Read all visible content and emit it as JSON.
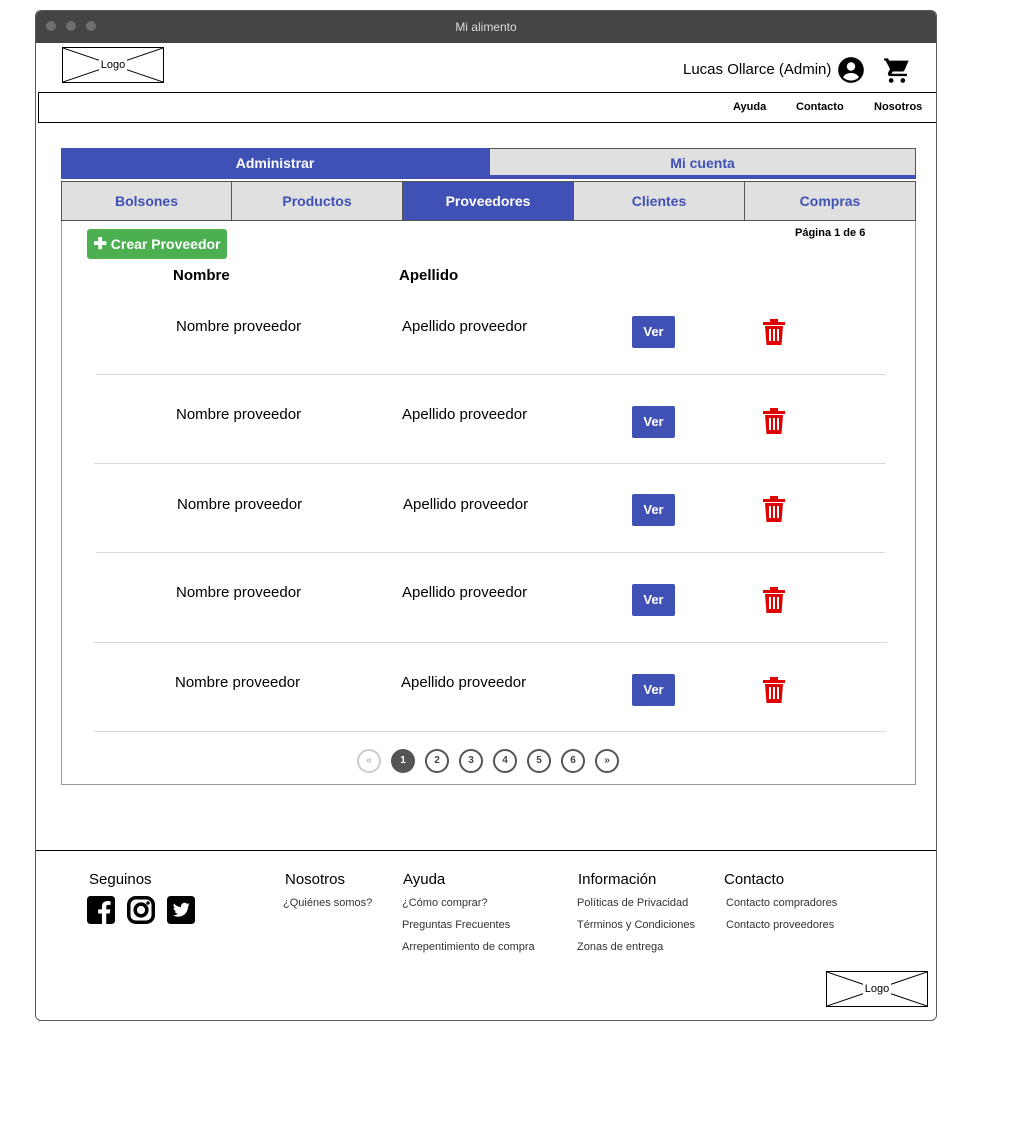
{
  "window": {
    "title": "Mi alimento"
  },
  "header": {
    "logo": "Logo",
    "user": "Lucas Ollarce (Admin)"
  },
  "nav": {
    "links": [
      "Ayuda",
      "Contacto",
      "Nosotros"
    ]
  },
  "main_tabs": [
    "Administrar",
    "Mi cuenta"
  ],
  "sub_tabs": [
    "Bolsones",
    "Productos",
    "Proveedores",
    "Clientes",
    "Compras"
  ],
  "toolbar": {
    "create_label": "Crear Proveedor",
    "page_info": "Página 1 de 6"
  },
  "table": {
    "columns": [
      "Nombre",
      "Apellido"
    ],
    "rows": [
      {
        "nombre": "Nombre proveedor",
        "apellido": "Apellido proveedor",
        "action": "Ver"
      },
      {
        "nombre": "Nombre proveedor",
        "apellido": "Apellido proveedor",
        "action": "Ver"
      },
      {
        "nombre": "Nombre proveedor",
        "apellido": "Apellido proveedor",
        "action": "Ver"
      },
      {
        "nombre": "Nombre proveedor",
        "apellido": "Apellido proveedor",
        "action": "Ver"
      },
      {
        "nombre": "Nombre proveedor",
        "apellido": "Apellido proveedor",
        "action": "Ver"
      }
    ]
  },
  "pagination": {
    "pages": [
      "1",
      "2",
      "3",
      "4",
      "5",
      "6"
    ],
    "current": "1",
    "prev": "«",
    "next": "»"
  },
  "footer": {
    "seguinos": "Seguinos",
    "nosotros": {
      "title": "Nosotros",
      "links": [
        "¿Quiénes somos?"
      ]
    },
    "ayuda": {
      "title": "Ayuda",
      "links": [
        "¿Cómo comprar?",
        "Preguntas Frecuentes",
        "Arrepentimiento de compra"
      ]
    },
    "informacion": {
      "title": "Información",
      "links": [
        "Políticas de Privacidad",
        "Términos y Condiciones",
        "Zonas de entrega"
      ]
    },
    "contacto": {
      "title": "Contacto",
      "links": [
        "Contacto compradores",
        "Contacto proveedores"
      ]
    },
    "logo": "Logo"
  },
  "colors": {
    "accent": "#3f51b5",
    "create": "#4caf50",
    "delete": "#e00000",
    "tab_inactive": "#e0e0e0"
  },
  "icons": [
    "user-icon",
    "cart-icon",
    "plus-icon",
    "trash-icon",
    "facebook-icon",
    "instagram-icon",
    "twitter-icon"
  ]
}
